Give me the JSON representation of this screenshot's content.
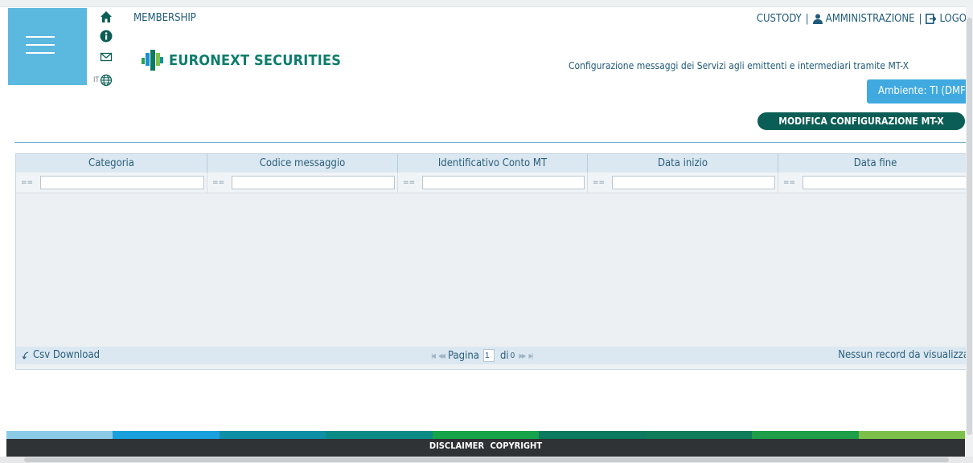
{
  "header": {
    "membership": "MEMBERSHIP",
    "logo_text": "EURONEXT SECURITIES",
    "lang_label": "IT",
    "subtitle": "Configurazione messaggi dei Servizi agli emittenti e intermediari tramite MT-X",
    "top_links": {
      "custody": "CUSTODY",
      "sep1": "|",
      "admin": "AMMINISTRAZIONE",
      "sep2": "|",
      "logout": "LOGO"
    },
    "environment": "Ambiente: TI (DMF",
    "action_button": "MODIFICA CONFIGURAZIONE MT-X"
  },
  "grid": {
    "columns": [
      "Categoria",
      "Codice messaggio",
      "Identificativo Conto MT",
      "Data inizio",
      "Data fine"
    ],
    "filter_operator": "==",
    "csv_label": "Csv Download",
    "page_label": "Pagina",
    "page_value": "1",
    "of_label": "di",
    "total_pages": "0",
    "no_records": "Nessun record da visualizza"
  },
  "footer": {
    "disclaimer": "DISCLAIMER",
    "copyright": "COPYRIGHT"
  },
  "colors": {
    "bar": [
      "#8ccbe8",
      "#1aa0dc",
      "#0f8fa6",
      "#0b8a86",
      "#16a34a",
      "#0b7a5f",
      "#0f7d5a",
      "#1f9e4a",
      "#7cc04a"
    ]
  }
}
